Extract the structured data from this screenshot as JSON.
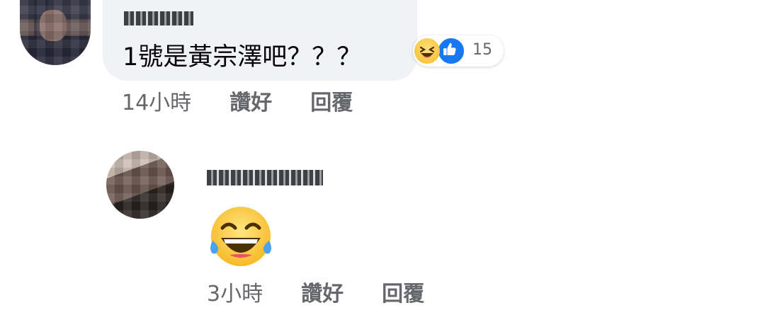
{
  "comment": {
    "text": "1號是黃宗澤吧？？？",
    "reactions": {
      "icons": [
        "haha-icon",
        "like-icon"
      ],
      "count": "15"
    },
    "meta": {
      "time": "14小時",
      "like_label": "讚好",
      "reply_label": "回覆"
    }
  },
  "reply": {
    "content_icon": "laughing-tears-emoji",
    "meta": {
      "time": "3小時",
      "like_label": "讚好",
      "reply_label": "回覆"
    }
  },
  "colors": {
    "bubble": "#f0f2f5",
    "meta_text": "#65676b",
    "like_blue": "#1877f2",
    "haha_yellow": "#f7b928"
  }
}
